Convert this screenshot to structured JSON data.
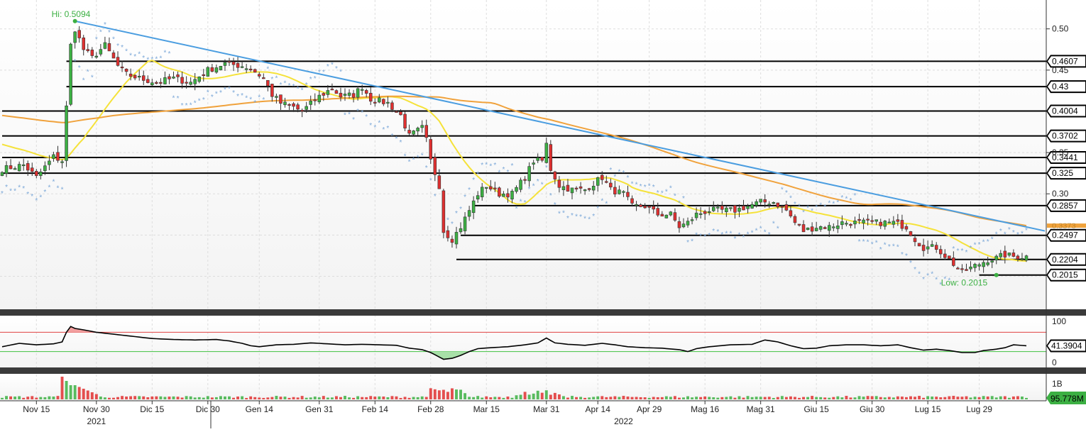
{
  "chart_data": {
    "type": "candlestick",
    "title": "",
    "currency_note": "",
    "price_ylim": [
      0.16,
      0.535
    ],
    "price_ticks": [
      0.5,
      0.45,
      0.35,
      0.3
    ],
    "price_tick_labels": [
      "0.50",
      "0.45",
      "0.35",
      "0.30"
    ],
    "high_annotation": {
      "label": "Hi: 0.5094",
      "date_index": 17,
      "value": 0.5094
    },
    "low_annotation": {
      "label": "Low: 0.2015",
      "date_index": 232,
      "value": 0.2015
    },
    "horizontal_levels": [
      {
        "value": 0.4607,
        "label": "0.4607",
        "start_index": 15
      },
      {
        "value": 0.43,
        "label": "0.43",
        "start_index": 15
      },
      {
        "value": 0.4004,
        "label": "0.4004",
        "start_index": 0
      },
      {
        "value": 0.3702,
        "label": "0.3702",
        "start_index": 0
      },
      {
        "value": 0.3441,
        "label": "0.3441",
        "start_index": 0
      },
      {
        "value": 0.325,
        "label": "0.325",
        "start_index": 0
      },
      {
        "value": 0.2857,
        "label": "0.2857",
        "start_index": 110
      },
      {
        "value": 0.2497,
        "label": "0.2497",
        "start_index": 107
      },
      {
        "value": 0.2204,
        "label": "0.2204",
        "start_index": 106
      },
      {
        "value": 0.2015,
        "label": "0.2015",
        "start_index": 228
      }
    ],
    "trendline": {
      "from": [
        17,
        0.5094
      ],
      "to": [
        239,
        0.255
      ],
      "color": "#4a9de0"
    },
    "sma_short_color": "#f5e23a",
    "sma_long_color": "#f0a23c",
    "sma_long_value_label": "0.3373",
    "sar_color": "#7aa7d8",
    "candle_up_color": "#3cb043",
    "candle_down_color": "#e03030",
    "x_axis_labels": [
      {
        "label": "Nov 15",
        "date_index": 8
      },
      {
        "label": "Nov 30",
        "date_index": 22
      },
      {
        "label": "Dic 15",
        "date_index": 35
      },
      {
        "label": "Dic 30",
        "date_index": 48
      },
      {
        "label": "Gen 14",
        "date_index": 60
      },
      {
        "label": "Gen 31",
        "date_index": 74
      },
      {
        "label": "Feb 14",
        "date_index": 87
      },
      {
        "label": "Feb 28",
        "date_index": 100
      },
      {
        "label": "Mar 15",
        "date_index": 113
      },
      {
        "label": "Mar 31",
        "date_index": 127
      },
      {
        "label": "Apr 14",
        "date_index": 139
      },
      {
        "label": "Apr 29",
        "date_index": 151
      },
      {
        "label": "Mag 16",
        "date_index": 164
      },
      {
        "label": "Mag 31",
        "date_index": 177
      },
      {
        "label": "Giu 15",
        "date_index": 190
      },
      {
        "label": "Giu 30",
        "date_index": 203
      },
      {
        "label": "Lug 15",
        "date_index": 216
      },
      {
        "label": "Lug 29",
        "date_index": 228
      }
    ],
    "year_labels": [
      {
        "label": "2021",
        "date_index": 22
      },
      {
        "label": "2022",
        "date_index": 145
      }
    ],
    "candles_count": 240,
    "ohlc_keyframes": [
      [
        0,
        0.33
      ],
      [
        5,
        0.335
      ],
      [
        8,
        0.32
      ],
      [
        12,
        0.345
      ],
      [
        14,
        0.34
      ],
      [
        15,
        0.405
      ],
      [
        16,
        0.48
      ],
      [
        17,
        0.5
      ],
      [
        19,
        0.475
      ],
      [
        21,
        0.465
      ],
      [
        24,
        0.48
      ],
      [
        27,
        0.455
      ],
      [
        29,
        0.445
      ],
      [
        32,
        0.44
      ],
      [
        36,
        0.435
      ],
      [
        40,
        0.44
      ],
      [
        44,
        0.435
      ],
      [
        48,
        0.45
      ],
      [
        52,
        0.458
      ],
      [
        56,
        0.455
      ],
      [
        58,
        0.452
      ],
      [
        61,
        0.44
      ],
      [
        63,
        0.42
      ],
      [
        65,
        0.41
      ],
      [
        68,
        0.405
      ],
      [
        70,
        0.4
      ],
      [
        74,
        0.418
      ],
      [
        77,
        0.428
      ],
      [
        79,
        0.418
      ],
      [
        82,
        0.42
      ],
      [
        84,
        0.43
      ],
      [
        86,
        0.415
      ],
      [
        90,
        0.41
      ],
      [
        93,
        0.395
      ],
      [
        95,
        0.37
      ],
      [
        98,
        0.38
      ],
      [
        99,
        0.365
      ],
      [
        100,
        0.34
      ],
      [
        102,
        0.31
      ],
      [
        103,
        0.255
      ],
      [
        105,
        0.245
      ],
      [
        107,
        0.26
      ],
      [
        109,
        0.28
      ],
      [
        111,
        0.3
      ],
      [
        113,
        0.31
      ],
      [
        116,
        0.3
      ],
      [
        119,
        0.3
      ],
      [
        122,
        0.32
      ],
      [
        124,
        0.34
      ],
      [
        126,
        0.34
      ],
      [
        127,
        0.36
      ],
      [
        128,
        0.33
      ],
      [
        130,
        0.31
      ],
      [
        133,
        0.305
      ],
      [
        136,
        0.305
      ],
      [
        140,
        0.32
      ],
      [
        142,
        0.305
      ],
      [
        145,
        0.3
      ],
      [
        147,
        0.285
      ],
      [
        150,
        0.285
      ],
      [
        153,
        0.275
      ],
      [
        156,
        0.275
      ],
      [
        158,
        0.26
      ],
      [
        160,
        0.265
      ],
      [
        162,
        0.275
      ],
      [
        165,
        0.28
      ],
      [
        168,
        0.28
      ],
      [
        171,
        0.28
      ],
      [
        174,
        0.285
      ],
      [
        177,
        0.29
      ],
      [
        180,
        0.29
      ],
      [
        183,
        0.28
      ],
      [
        185,
        0.265
      ],
      [
        187,
        0.255
      ],
      [
        190,
        0.26
      ],
      [
        193,
        0.26
      ],
      [
        196,
        0.265
      ],
      [
        200,
        0.265
      ],
      [
        204,
        0.265
      ],
      [
        208,
        0.265
      ],
      [
        211,
        0.26
      ],
      [
        213,
        0.245
      ],
      [
        215,
        0.235
      ],
      [
        218,
        0.235
      ],
      [
        220,
        0.225
      ],
      [
        222,
        0.215
      ],
      [
        224,
        0.205
      ],
      [
        226,
        0.21
      ],
      [
        228,
        0.215
      ],
      [
        230,
        0.22
      ],
      [
        232,
        0.222
      ],
      [
        234,
        0.226
      ],
      [
        236,
        0.224
      ],
      [
        239,
        0.224
      ]
    ],
    "rsi": {
      "ylim": [
        0,
        100
      ],
      "tick_labels": [
        "100",
        "0"
      ],
      "upper_band": 70,
      "lower_band": 30,
      "last_value_label": "41.3904",
      "keyframes": [
        [
          0,
          40
        ],
        [
          4,
          47
        ],
        [
          8,
          44
        ],
        [
          12,
          46
        ],
        [
          14,
          50
        ],
        [
          15,
          70
        ],
        [
          16,
          82
        ],
        [
          17,
          78
        ],
        [
          19,
          75
        ],
        [
          22,
          70
        ],
        [
          26,
          66
        ],
        [
          30,
          62
        ],
        [
          35,
          57
        ],
        [
          40,
          55
        ],
        [
          45,
          54
        ],
        [
          50,
          55
        ],
        [
          53,
          52
        ],
        [
          56,
          47
        ],
        [
          58,
          42
        ],
        [
          60,
          40
        ],
        [
          64,
          44
        ],
        [
          68,
          45
        ],
        [
          72,
          48
        ],
        [
          76,
          46
        ],
        [
          80,
          44
        ],
        [
          84,
          45
        ],
        [
          88,
          44
        ],
        [
          92,
          43
        ],
        [
          95,
          37
        ],
        [
          98,
          34
        ],
        [
          100,
          28
        ],
        [
          103,
          14
        ],
        [
          105,
          16
        ],
        [
          107,
          22
        ],
        [
          109,
          30
        ],
        [
          111,
          36
        ],
        [
          114,
          38
        ],
        [
          118,
          40
        ],
        [
          122,
          44
        ],
        [
          125,
          48
        ],
        [
          127,
          58
        ],
        [
          129,
          48
        ],
        [
          132,
          45
        ],
        [
          136,
          43
        ],
        [
          140,
          47
        ],
        [
          143,
          44
        ],
        [
          146,
          40
        ],
        [
          150,
          38
        ],
        [
          154,
          37
        ],
        [
          158,
          34
        ],
        [
          160,
          30
        ],
        [
          162,
          36
        ],
        [
          165,
          40
        ],
        [
          170,
          44
        ],
        [
          175,
          45
        ],
        [
          178,
          54
        ],
        [
          181,
          50
        ],
        [
          184,
          42
        ],
        [
          187,
          36
        ],
        [
          190,
          37
        ],
        [
          193,
          42
        ],
        [
          197,
          44
        ],
        [
          201,
          44
        ],
        [
          205,
          42
        ],
        [
          209,
          44
        ],
        [
          212,
          38
        ],
        [
          215,
          33
        ],
        [
          218,
          35
        ],
        [
          221,
          32
        ],
        [
          224,
          28
        ],
        [
          227,
          28
        ],
        [
          229,
          32
        ],
        [
          232,
          35
        ],
        [
          234,
          38
        ],
        [
          236,
          44
        ],
        [
          239,
          42
        ]
      ]
    },
    "volume": {
      "tick_label": "1B",
      "last_value_label": "95.778M"
    }
  }
}
